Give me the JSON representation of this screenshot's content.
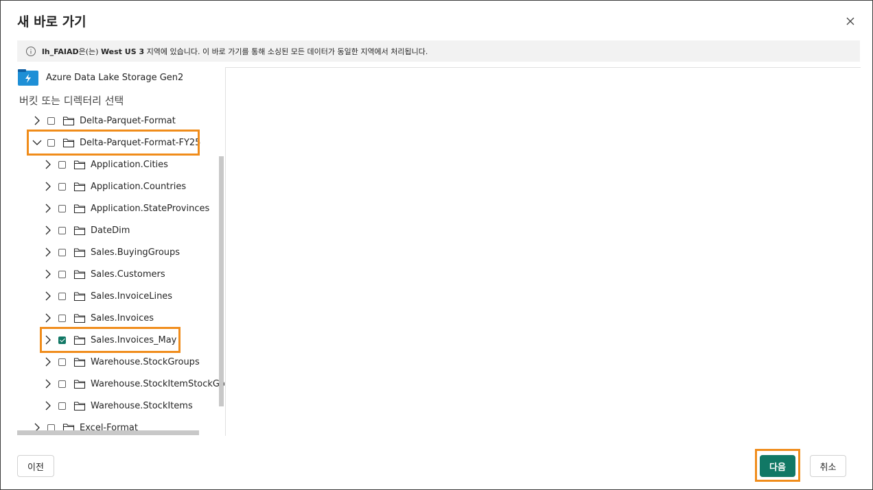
{
  "dialog": {
    "title": "새 바로 가기",
    "close_icon": "close-icon"
  },
  "info": {
    "lakehouse": "lh_FAIAD",
    "text_a": "은(는) ",
    "region": "West US 3",
    "text_b": " 지역에 있습니다. 이 바로 가기를 통해 소싱된 모든 데이터가 동일한 지역에서 처리됩니다."
  },
  "source": {
    "label": "Azure Data Lake Storage Gen2",
    "icon": "adls-gen2-icon"
  },
  "tree": {
    "heading": "버킷 또는 디렉터리 선택",
    "items": [
      {
        "label": "Delta-Parquet-Format",
        "level": 0,
        "expanded": false,
        "checked": false
      },
      {
        "label": "Delta-Parquet-Format-FY25",
        "level": 0,
        "expanded": true,
        "checked": false
      },
      {
        "label": "Application.Cities",
        "level": 1,
        "expanded": false,
        "checked": false
      },
      {
        "label": "Application.Countries",
        "level": 1,
        "expanded": false,
        "checked": false
      },
      {
        "label": "Application.StateProvinces",
        "level": 1,
        "expanded": false,
        "checked": false
      },
      {
        "label": "DateDim",
        "level": 1,
        "expanded": false,
        "checked": false
      },
      {
        "label": "Sales.BuyingGroups",
        "level": 1,
        "expanded": false,
        "checked": false
      },
      {
        "label": "Sales.Customers",
        "level": 1,
        "expanded": false,
        "checked": false
      },
      {
        "label": "Sales.InvoiceLines",
        "level": 1,
        "expanded": false,
        "checked": false
      },
      {
        "label": "Sales.Invoices",
        "level": 1,
        "expanded": false,
        "checked": false
      },
      {
        "label": "Sales.Invoices_May",
        "level": 1,
        "expanded": false,
        "checked": true
      },
      {
        "label": "Warehouse.StockGroups",
        "level": 1,
        "expanded": false,
        "checked": false
      },
      {
        "label": "Warehouse.StockItemStockGroups",
        "level": 1,
        "expanded": false,
        "checked": false
      },
      {
        "label": "Warehouse.StockItems",
        "level": 1,
        "expanded": false,
        "checked": false
      },
      {
        "label": "Excel-Format",
        "level": 0,
        "expanded": false,
        "checked": false
      }
    ]
  },
  "footer": {
    "back_label": "이전",
    "next_label": "다음",
    "cancel_label": "취소"
  },
  "colors": {
    "accent": "#117865",
    "highlight": "#f08c1a"
  }
}
